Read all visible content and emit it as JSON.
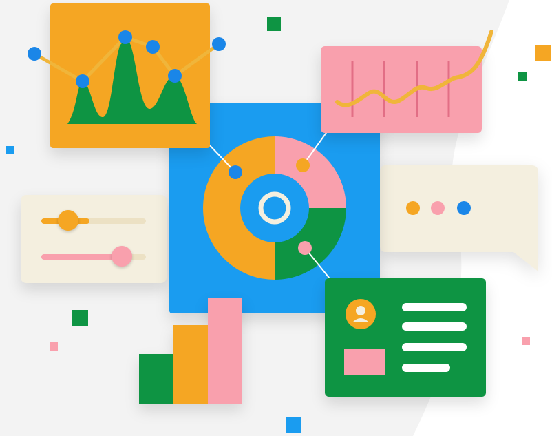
{
  "colors": {
    "background_blob": "#f3f3f3",
    "orange": "#f5a623",
    "green": "#0e9443",
    "pink": "#f9a0ad",
    "blue": "#1a9cf0",
    "dark_blue": "#0c7fd8",
    "cream": "#f4efdf",
    "line_gold": "#f0b53a",
    "dot_blue": "#1a86e8",
    "white": "#ffffff"
  },
  "icons": {
    "person": "user-avatar-icon",
    "ring": "donut-center-icon"
  },
  "illustration": {
    "panels": [
      "mountain-line-chart-card",
      "wave-line-chart-card",
      "donut-chart-card",
      "slider-controls-card",
      "chat-bubble-card",
      "profile-card",
      "bar-chart-stack"
    ]
  }
}
